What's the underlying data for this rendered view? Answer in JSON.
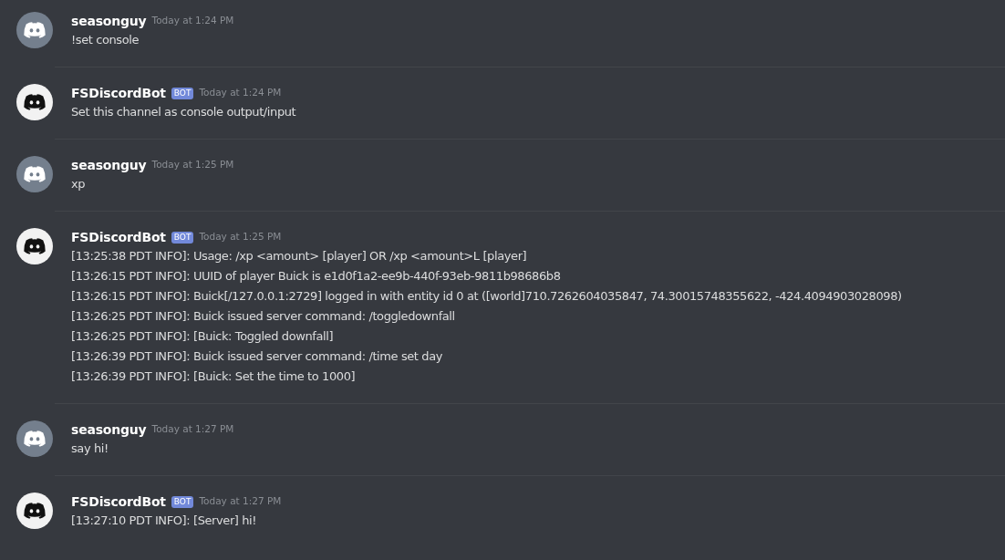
{
  "messages": [
    {
      "author": "seasonguy",
      "kind": "user",
      "timestamp": "Today at 1:24 PM",
      "lines": [
        "!set console"
      ]
    },
    {
      "author": "FSDiscordBot",
      "kind": "bot",
      "badge": "BOT",
      "timestamp": "Today at 1:24 PM",
      "lines": [
        "Set this channel as console output/input"
      ]
    },
    {
      "author": "seasonguy",
      "kind": "user",
      "timestamp": "Today at 1:25 PM",
      "lines": [
        "xp"
      ]
    },
    {
      "author": "FSDiscordBot",
      "kind": "bot",
      "badge": "BOT",
      "timestamp": "Today at 1:25 PM",
      "lines": [
        "[13:25:38 PDT INFO]: Usage: /xp <amount> [player] OR /xp <amount>L [player]",
        "[13:26:15 PDT INFO]: UUID of player Buick is e1d0f1a2-ee9b-440f-93eb-9811b98686b8",
        "[13:26:15 PDT INFO]: Buick[/127.0.0.1:2729] logged in with entity id 0 at ([world]710.7262604035847, 74.30015748355622, -424.4094903028098)",
        "[13:26:25 PDT INFO]: Buick issued server command: /toggledownfall",
        "[13:26:25 PDT INFO]: [Buick: Toggled downfall]",
        "[13:26:39 PDT INFO]: Buick issued server command: /time set day",
        "[13:26:39 PDT INFO]: [Buick: Set the time to 1000]"
      ]
    },
    {
      "author": "seasonguy",
      "kind": "user",
      "timestamp": "Today at 1:27 PM",
      "lines": [
        "say hi!"
      ]
    },
    {
      "author": "FSDiscordBot",
      "kind": "bot",
      "badge": "BOT",
      "timestamp": "Today at 1:27 PM",
      "lines": [
        "[13:27:10 PDT INFO]: [Server] hi!"
      ]
    }
  ]
}
